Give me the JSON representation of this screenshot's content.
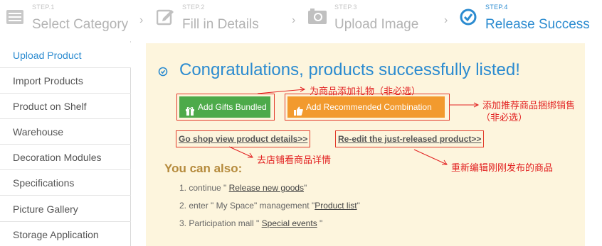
{
  "steps": [
    {
      "num": "STEP.1",
      "label": "Select Category",
      "icon": "list-icon"
    },
    {
      "num": "STEP.2",
      "label": "Fill in Details",
      "icon": "edit-icon"
    },
    {
      "num": "STEP.3",
      "label": "Upload Image",
      "icon": "camera-icon"
    },
    {
      "num": "STEP.4",
      "label": "Release Success",
      "icon": "check-circle-icon"
    }
  ],
  "sidebar": {
    "items": [
      {
        "label": "Upload Product"
      },
      {
        "label": "Import Products"
      },
      {
        "label": "Product on Shelf"
      },
      {
        "label": "Warehouse"
      },
      {
        "label": "Decoration Modules"
      },
      {
        "label": "Specifications"
      },
      {
        "label": "Picture Gallery"
      },
      {
        "label": "Storage Application"
      }
    ]
  },
  "main": {
    "congrats": "Congratulations, products successfully listed!",
    "buttons": {
      "gifts": "Add Gifts Bundled",
      "combination": "Add Recommended Combination"
    },
    "links": {
      "view": "Go shop view product details>>",
      "reedit": "Re-edit the just-released product>>"
    },
    "also_title": "You can also:",
    "also_items": [
      {
        "prefix": "1. continue \" ",
        "link": "Release new goods",
        "suffix": "\""
      },
      {
        "prefix": "2. enter \" My Space\" management \"",
        "link": "Product list",
        "suffix": "\""
      },
      {
        "prefix": "3. Participation mall \" ",
        "link": "Special events",
        "suffix": " \""
      }
    ]
  },
  "annotations": {
    "gifts": "为商品添加礼物（非必选）",
    "combination_1": "添加推荐商品捆绑销售",
    "combination_2": "（非必选）",
    "view": "去店铺看商品详情",
    "reedit": "重新编辑刚刚发布的商品"
  },
  "colors": {
    "accent": "#2b8bd0",
    "panel_bg": "#fdf5dd",
    "green_button": "#4daa4a",
    "orange_button": "#f29a2e",
    "annotation": "#e22222"
  }
}
